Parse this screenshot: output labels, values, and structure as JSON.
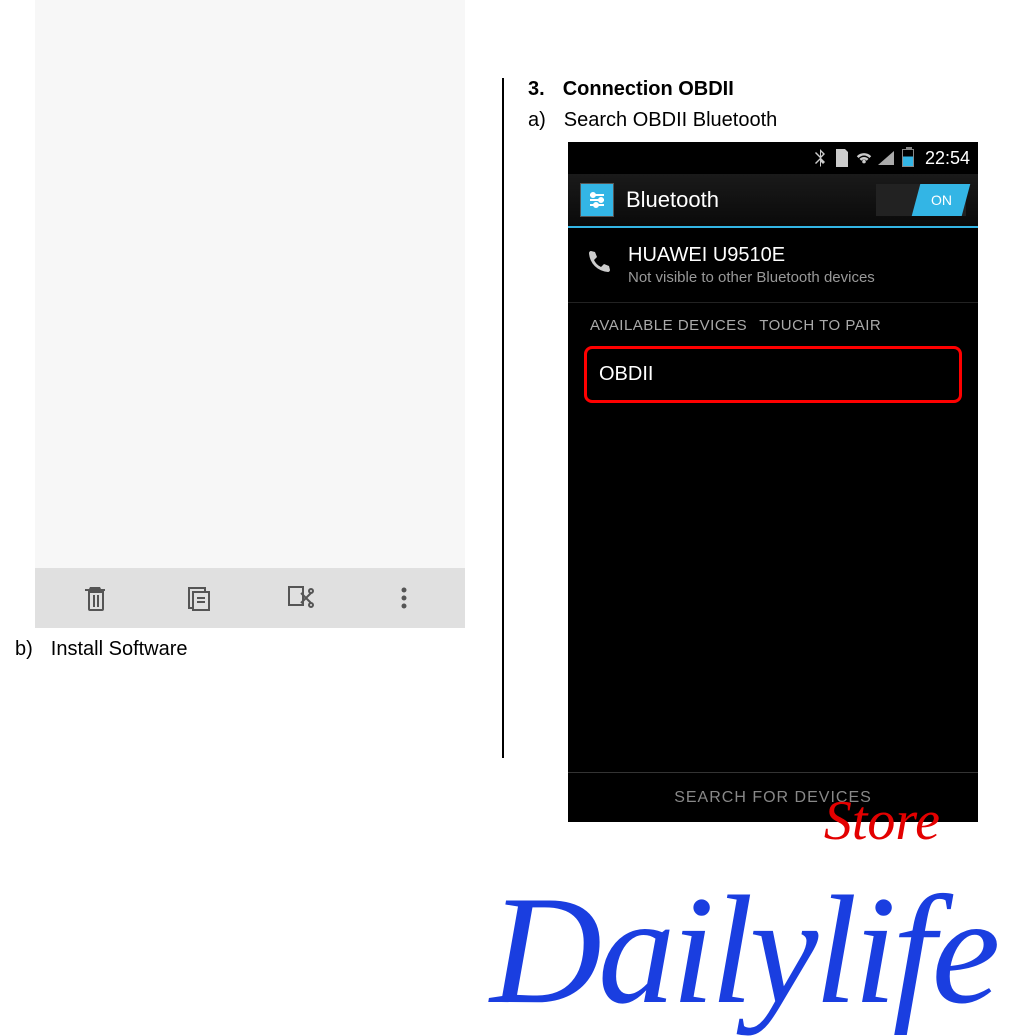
{
  "left": {
    "caption_letter": "b)",
    "caption_text": "Install Software",
    "toolbar": {
      "delete": "trash-icon",
      "copy": "copy-icon",
      "cut": "cut-icon",
      "more": "more-icon"
    }
  },
  "right": {
    "step_num": "3.",
    "step_title": "Connection OBDII",
    "sub_letter": "a)",
    "sub_text": "Search OBDII Bluetooth"
  },
  "phone": {
    "status_time": "22:54",
    "bt_title": "Bluetooth",
    "toggle_label": "ON",
    "device_name": "HUAWEI U9510E",
    "device_sub": "Not visible to other Bluetooth devices",
    "avail_label": "AVAILABLE DEVICES",
    "pair_hint": "TOUCH TO PAIR",
    "found_device": "OBDII",
    "search_btn": "SEARCH FOR DEVICES"
  },
  "watermark": {
    "store": "Store",
    "main": "Dailylife"
  }
}
